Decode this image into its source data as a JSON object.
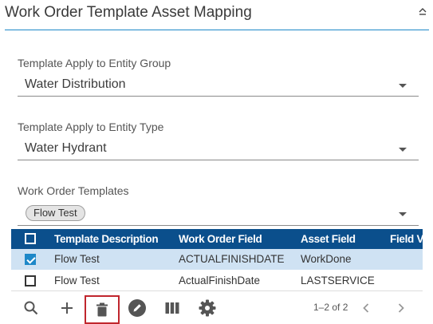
{
  "header": {
    "title": "Work Order Template Asset Mapping",
    "collapse_icon": "collapse-icon"
  },
  "form": {
    "entity_group": {
      "label": "Template Apply to Entity Group",
      "value": "Water Distribution"
    },
    "entity_type": {
      "label": "Template Apply to Entity Type",
      "value": "Water Hydrant"
    },
    "templates": {
      "label": "Work Order Templates",
      "chips": [
        "Flow Test"
      ]
    }
  },
  "grid": {
    "columns": [
      "Template Description",
      "Work Order Field",
      "Asset Field",
      "Field V"
    ],
    "rows": [
      {
        "selected": true,
        "cells": [
          "Flow Test",
          "ACTUALFINISHDATE",
          "WorkDone",
          ""
        ]
      },
      {
        "selected": false,
        "cells": [
          "Flow Test",
          "ActualFinishDate",
          "LASTSERVICE",
          ""
        ]
      }
    ]
  },
  "toolbar": {
    "buttons": [
      "search-icon",
      "add-icon",
      "delete-icon",
      "edit-icon",
      "columns-icon",
      "settings-icon"
    ],
    "pager": {
      "text": "1–2 of 2"
    }
  },
  "colors": {
    "accent": "#1e88c8",
    "grid_header": "#0b4f8c",
    "selected_row": "#cfe2f3",
    "focus_outline": "#c0262d"
  }
}
